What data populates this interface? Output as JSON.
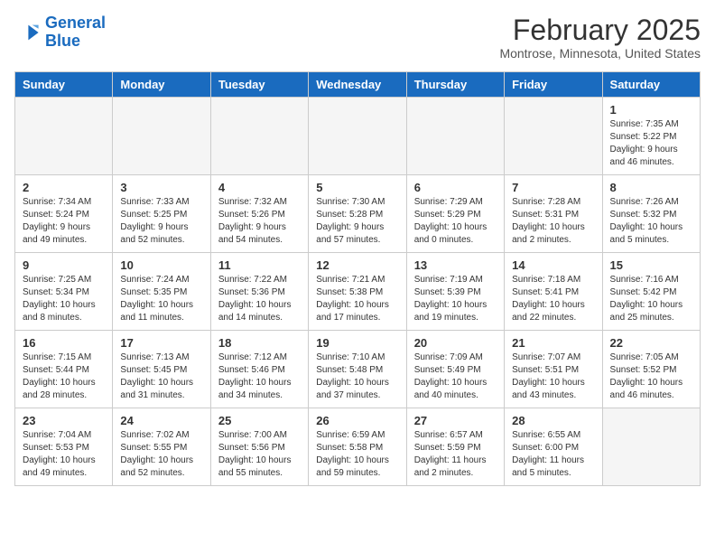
{
  "header": {
    "logo_line1": "General",
    "logo_line2": "Blue",
    "month": "February 2025",
    "location": "Montrose, Minnesota, United States"
  },
  "weekdays": [
    "Sunday",
    "Monday",
    "Tuesday",
    "Wednesday",
    "Thursday",
    "Friday",
    "Saturday"
  ],
  "weeks": [
    [
      {
        "day": "",
        "info": ""
      },
      {
        "day": "",
        "info": ""
      },
      {
        "day": "",
        "info": ""
      },
      {
        "day": "",
        "info": ""
      },
      {
        "day": "",
        "info": ""
      },
      {
        "day": "",
        "info": ""
      },
      {
        "day": "1",
        "info": "Sunrise: 7:35 AM\nSunset: 5:22 PM\nDaylight: 9 hours and 46 minutes."
      }
    ],
    [
      {
        "day": "2",
        "info": "Sunrise: 7:34 AM\nSunset: 5:24 PM\nDaylight: 9 hours and 49 minutes."
      },
      {
        "day": "3",
        "info": "Sunrise: 7:33 AM\nSunset: 5:25 PM\nDaylight: 9 hours and 52 minutes."
      },
      {
        "day": "4",
        "info": "Sunrise: 7:32 AM\nSunset: 5:26 PM\nDaylight: 9 hours and 54 minutes."
      },
      {
        "day": "5",
        "info": "Sunrise: 7:30 AM\nSunset: 5:28 PM\nDaylight: 9 hours and 57 minutes."
      },
      {
        "day": "6",
        "info": "Sunrise: 7:29 AM\nSunset: 5:29 PM\nDaylight: 10 hours and 0 minutes."
      },
      {
        "day": "7",
        "info": "Sunrise: 7:28 AM\nSunset: 5:31 PM\nDaylight: 10 hours and 2 minutes."
      },
      {
        "day": "8",
        "info": "Sunrise: 7:26 AM\nSunset: 5:32 PM\nDaylight: 10 hours and 5 minutes."
      }
    ],
    [
      {
        "day": "9",
        "info": "Sunrise: 7:25 AM\nSunset: 5:34 PM\nDaylight: 10 hours and 8 minutes."
      },
      {
        "day": "10",
        "info": "Sunrise: 7:24 AM\nSunset: 5:35 PM\nDaylight: 10 hours and 11 minutes."
      },
      {
        "day": "11",
        "info": "Sunrise: 7:22 AM\nSunset: 5:36 PM\nDaylight: 10 hours and 14 minutes."
      },
      {
        "day": "12",
        "info": "Sunrise: 7:21 AM\nSunset: 5:38 PM\nDaylight: 10 hours and 17 minutes."
      },
      {
        "day": "13",
        "info": "Sunrise: 7:19 AM\nSunset: 5:39 PM\nDaylight: 10 hours and 19 minutes."
      },
      {
        "day": "14",
        "info": "Sunrise: 7:18 AM\nSunset: 5:41 PM\nDaylight: 10 hours and 22 minutes."
      },
      {
        "day": "15",
        "info": "Sunrise: 7:16 AM\nSunset: 5:42 PM\nDaylight: 10 hours and 25 minutes."
      }
    ],
    [
      {
        "day": "16",
        "info": "Sunrise: 7:15 AM\nSunset: 5:44 PM\nDaylight: 10 hours and 28 minutes."
      },
      {
        "day": "17",
        "info": "Sunrise: 7:13 AM\nSunset: 5:45 PM\nDaylight: 10 hours and 31 minutes."
      },
      {
        "day": "18",
        "info": "Sunrise: 7:12 AM\nSunset: 5:46 PM\nDaylight: 10 hours and 34 minutes."
      },
      {
        "day": "19",
        "info": "Sunrise: 7:10 AM\nSunset: 5:48 PM\nDaylight: 10 hours and 37 minutes."
      },
      {
        "day": "20",
        "info": "Sunrise: 7:09 AM\nSunset: 5:49 PM\nDaylight: 10 hours and 40 minutes."
      },
      {
        "day": "21",
        "info": "Sunrise: 7:07 AM\nSunset: 5:51 PM\nDaylight: 10 hours and 43 minutes."
      },
      {
        "day": "22",
        "info": "Sunrise: 7:05 AM\nSunset: 5:52 PM\nDaylight: 10 hours and 46 minutes."
      }
    ],
    [
      {
        "day": "23",
        "info": "Sunrise: 7:04 AM\nSunset: 5:53 PM\nDaylight: 10 hours and 49 minutes."
      },
      {
        "day": "24",
        "info": "Sunrise: 7:02 AM\nSunset: 5:55 PM\nDaylight: 10 hours and 52 minutes."
      },
      {
        "day": "25",
        "info": "Sunrise: 7:00 AM\nSunset: 5:56 PM\nDaylight: 10 hours and 55 minutes."
      },
      {
        "day": "26",
        "info": "Sunrise: 6:59 AM\nSunset: 5:58 PM\nDaylight: 10 hours and 59 minutes."
      },
      {
        "day": "27",
        "info": "Sunrise: 6:57 AM\nSunset: 5:59 PM\nDaylight: 11 hours and 2 minutes."
      },
      {
        "day": "28",
        "info": "Sunrise: 6:55 AM\nSunset: 6:00 PM\nDaylight: 11 hours and 5 minutes."
      },
      {
        "day": "",
        "info": ""
      }
    ]
  ]
}
